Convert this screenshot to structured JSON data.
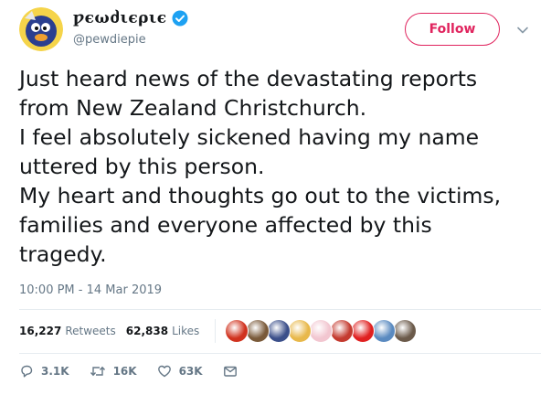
{
  "user": {
    "display_name": "ƿєωძιєριє",
    "handle": "@pewdiepie",
    "verified": true,
    "avatar_icon": "avatar-cartoon-icon"
  },
  "header": {
    "follow_label": "Follow",
    "menu_icon": "chevron-down-icon"
  },
  "tweet": {
    "lines": [
      "Just heard news of the devastating reports",
      "from New Zealand Christchurch.",
      "I feel absolutely sickened having my name",
      "uttered by this person.",
      "My heart and thoughts go out to the victims,",
      "families and everyone affected by this",
      "tragedy."
    ],
    "timestamp": "10:00 PM - 14 Mar 2019"
  },
  "stats": {
    "retweets_count": "16,227",
    "retweets_label": "Retweets",
    "likes_count": "62,838",
    "likes_label": "Likes",
    "liker_colors": [
      "#d0321e",
      "#7a5a3a",
      "#3b4f8a",
      "#e8b84a",
      "#f2c6d0",
      "#c43a2f",
      "#e02020",
      "#5a8ac0",
      "#6b5a4a"
    ]
  },
  "actions": {
    "reply_count": "3.1K",
    "retweet_count": "16K",
    "like_count": "63K"
  },
  "colors": {
    "accent": "#e0245e",
    "verified": "#1da1f2",
    "muted": "#657786"
  }
}
